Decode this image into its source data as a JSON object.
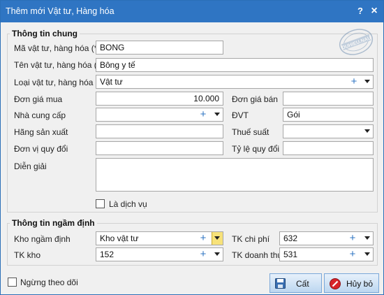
{
  "window": {
    "title": "Thêm mới Vật tư, Hàng hóa",
    "help_label": "?",
    "close_label": "×"
  },
  "watermark": {
    "text": "DUHIEU.NAU",
    "icon": "stamp-logo"
  },
  "general": {
    "legend": "Thông tin chung",
    "code": {
      "label": "Mã vật tư, hàng hóa (*)",
      "value": "BONG"
    },
    "name": {
      "label": "Tên vật tư, hàng hóa (*)",
      "value": "Bông y tế"
    },
    "type": {
      "label": "Loại vật tư, hàng hóa (*)",
      "value": "Vật tư"
    },
    "buy_price": {
      "label": "Đơn giá mua",
      "value": "10.000"
    },
    "sell_price": {
      "label": "Đơn giá bán",
      "value": ""
    },
    "supplier": {
      "label": "Nhà cung cấp",
      "value": ""
    },
    "unit": {
      "label": "ĐVT",
      "value": "Gói"
    },
    "manufacturer": {
      "label": "Hãng sản xuất",
      "value": ""
    },
    "tax_rate": {
      "label": "Thuế suất",
      "value": ""
    },
    "conv_unit": {
      "label": "Đơn vị quy đổi",
      "value": ""
    },
    "conv_ratio": {
      "label": "Tỷ lệ quy đổi",
      "value": ""
    },
    "description": {
      "label": "Diễn giải",
      "value": ""
    },
    "is_service": {
      "label": "Là dịch vụ",
      "checked": false
    }
  },
  "defaults": {
    "legend": "Thông tin ngầm định",
    "default_warehouse": {
      "label": "Kho ngầm định",
      "value": "Kho vật tư"
    },
    "expense_account": {
      "label": "TK chi phí",
      "value": "632"
    },
    "warehouse_account": {
      "label": "TK kho",
      "value": "152"
    },
    "revenue_account": {
      "label": "TK doanh thu",
      "value": "531"
    }
  },
  "footer": {
    "stop_tracking": {
      "label": "Ngừng theo dõi",
      "checked": false
    },
    "save_label": "Cất",
    "cancel_label": "Hủy bỏ"
  },
  "colors": {
    "titlebar": "#2f75c3",
    "accent": "#2f75c3",
    "button_top": "#e7f1fb",
    "button_bottom": "#bcd6f0"
  }
}
